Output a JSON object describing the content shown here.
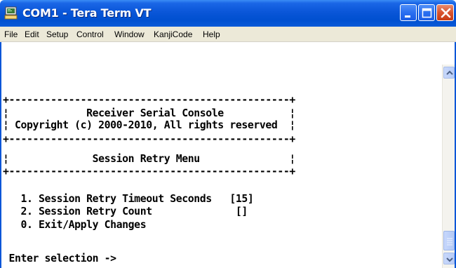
{
  "window": {
    "title": "COM1 - Tera Term VT",
    "icon": "tera-term-icon",
    "controls": [
      "minimize-icon",
      "maximize-icon",
      "close-icon"
    ]
  },
  "menubar": {
    "items": [
      {
        "label": "File",
        "name": "menu-file"
      },
      {
        "label": "Edit",
        "name": "menu-edit"
      },
      {
        "label": "Setup",
        "name": "menu-setup"
      },
      {
        "label": "Control",
        "name": "menu-control"
      },
      {
        "label": "Window",
        "name": "menu-window"
      },
      {
        "label": "KanjiCode",
        "name": "menu-kanjicode"
      },
      {
        "label": "Help",
        "name": "menu-help"
      }
    ]
  },
  "terminal": {
    "lines": [
      "",
      "+-----------------------------------------------+",
      "¦             Receiver Serial Console           ¦",
      "¦ Copyright (c) 2000-2010, All rights reserved  ¦",
      "+-----------------------------------------------+",
      "¦              Session Retry Menu               ¦",
      "+-----------------------------------------------+",
      "",
      "   1. Session Retry Timeout Seconds   [15]",
      "   2. Session Retry Count              []",
      "   0. Exit/Apply Changes",
      "",
      " Enter selection ->"
    ]
  },
  "colors": {
    "titlebar": "#0a56d8",
    "close_button": "#d8532f",
    "menubar": "#ece9d8",
    "terminal_background": "#ffffff",
    "terminal_text": "#000000"
  }
}
